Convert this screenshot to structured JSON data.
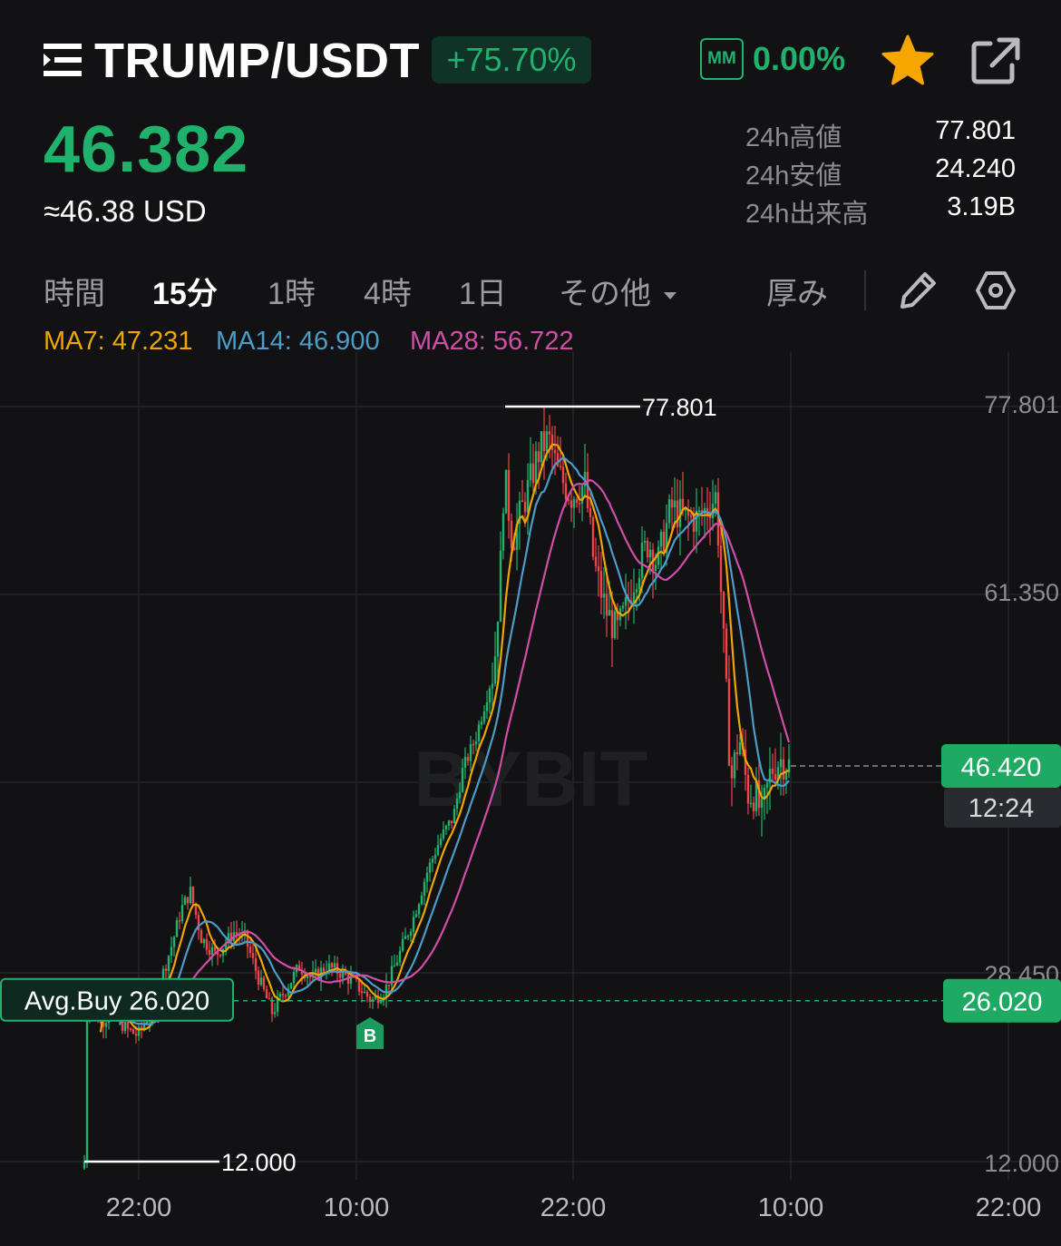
{
  "header": {
    "pair": "TRUMP/USDT",
    "change_pct": "+75.70%",
    "mm_label": "MM",
    "mm_value": "0.00%",
    "icons": [
      "menu-icon",
      "star-icon",
      "share-icon"
    ]
  },
  "price": {
    "last": "46.382",
    "usd": "≈46.38 USD"
  },
  "stats": [
    {
      "label": "24h高値",
      "value": "77.801"
    },
    {
      "label": "24h安値",
      "value": "24.240"
    },
    {
      "label": "24h出来高",
      "value": "3.19B"
    }
  ],
  "tabs": {
    "time": "時間",
    "m15": "15分",
    "h1": "1時",
    "h4": "4時",
    "d1": "1日",
    "more": "その他",
    "depth": "厚み"
  },
  "ma": {
    "ma7": "MA7: 47.231",
    "ma14": "MA14: 46.900",
    "ma28": "MA28: 56.722"
  },
  "colors": {
    "up": "#20b26c",
    "down": "#ef454a",
    "ma7": "#f0a500",
    "ma14": "#4b9cc8",
    "ma28": "#d14ea8",
    "star": "#f7a600"
  },
  "chart_data": {
    "type": "candlestick",
    "watermark": "BYBIT",
    "y_ticks": [
      "77.801",
      "61.350",
      "28.450",
      "12.000"
    ],
    "y_range": [
      12.0,
      77.801
    ],
    "x_ticks": [
      "22:00",
      "10:00",
      "22:00",
      "10:00",
      "22:00"
    ],
    "high_marker": "77.801",
    "low_marker": "12.000",
    "current_price_tag": "46.420",
    "countdown": "12:24",
    "avg_buy_label": "Avg.Buy 26.020",
    "avg_buy_price": "26.020",
    "buy_marker": "B",
    "series": [
      {
        "name": "MA7",
        "value": 47.231
      },
      {
        "name": "MA14",
        "value": 46.9
      },
      {
        "name": "MA28",
        "value": 56.722
      }
    ]
  }
}
